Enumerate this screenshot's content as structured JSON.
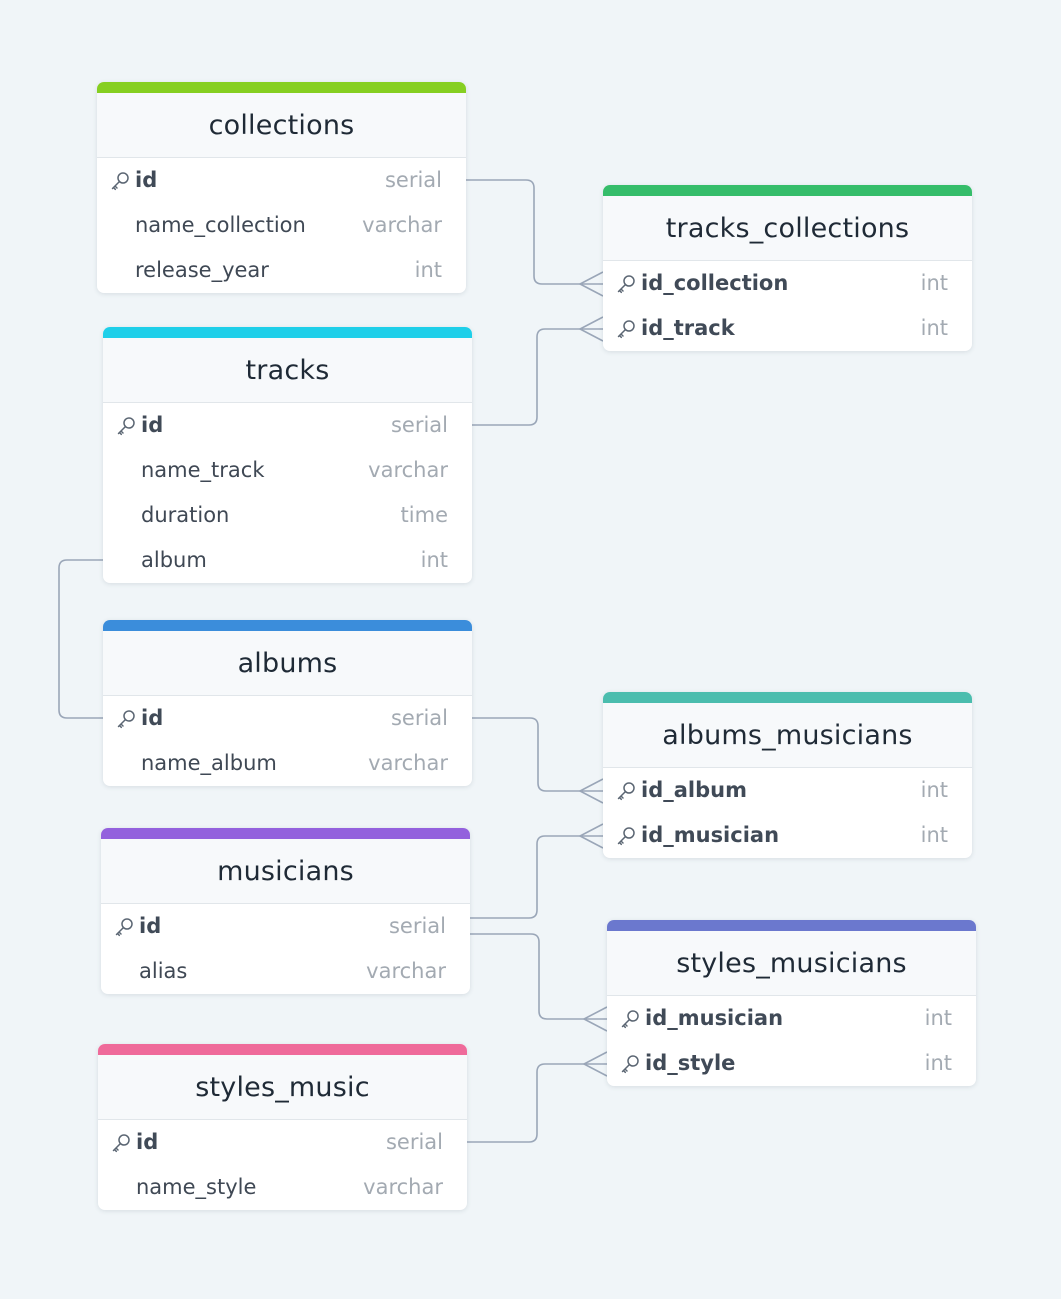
{
  "colors": {
    "background": "#f0f5f8",
    "line": "#9aa6b8",
    "collections": "#86cf21",
    "tracks": "#1ecfe9",
    "albums": "#3b8ddb",
    "musicians": "#9361dd",
    "styles_music": "#ef6a9a",
    "tracks_collections": "#35bd6a",
    "albums_musicians": "#4bbdae",
    "styles_musicians": "#6b78ce"
  },
  "tables": {
    "collections": {
      "name": "collections",
      "fields": [
        {
          "name": "id",
          "type": "serial",
          "pk": true
        },
        {
          "name": "name_collection",
          "type": "varchar",
          "pk": false
        },
        {
          "name": "release_year",
          "type": "int",
          "pk": false
        }
      ]
    },
    "tracks": {
      "name": "tracks",
      "fields": [
        {
          "name": "id",
          "type": "serial",
          "pk": true
        },
        {
          "name": "name_track",
          "type": "varchar",
          "pk": false
        },
        {
          "name": "duration",
          "type": "time",
          "pk": false
        },
        {
          "name": "album",
          "type": "int",
          "pk": false
        }
      ]
    },
    "albums": {
      "name": "albums",
      "fields": [
        {
          "name": "id",
          "type": "serial",
          "pk": true
        },
        {
          "name": "name_album",
          "type": "varchar",
          "pk": false
        }
      ]
    },
    "musicians": {
      "name": "musicians",
      "fields": [
        {
          "name": "id",
          "type": "serial",
          "pk": true
        },
        {
          "name": "alias",
          "type": "varchar",
          "pk": false
        }
      ]
    },
    "styles_music": {
      "name": "styles_music",
      "fields": [
        {
          "name": "id",
          "type": "serial",
          "pk": true
        },
        {
          "name": "name_style",
          "type": "varchar",
          "pk": false
        }
      ]
    },
    "tracks_collections": {
      "name": "tracks_collections",
      "fields": [
        {
          "name": "id_collection",
          "type": "int",
          "pk": true
        },
        {
          "name": "id_track",
          "type": "int",
          "pk": true
        }
      ]
    },
    "albums_musicians": {
      "name": "albums_musicians",
      "fields": [
        {
          "name": "id_album",
          "type": "int",
          "pk": true
        },
        {
          "name": "id_musician",
          "type": "int",
          "pk": true
        }
      ]
    },
    "styles_musicians": {
      "name": "styles_musicians",
      "fields": [
        {
          "name": "id_musician",
          "type": "int",
          "pk": true
        },
        {
          "name": "id_style",
          "type": "int",
          "pk": true
        }
      ]
    }
  },
  "relations": [
    {
      "from": "collections.id",
      "to": "tracks_collections.id_collection",
      "to_cardinality": "many"
    },
    {
      "from": "tracks.id",
      "to": "tracks_collections.id_track",
      "to_cardinality": "many"
    },
    {
      "from": "tracks.album",
      "to": "albums.id",
      "to_cardinality": "one"
    },
    {
      "from": "albums.id",
      "to": "albums_musicians.id_album",
      "to_cardinality": "many"
    },
    {
      "from": "musicians.id",
      "to": "albums_musicians.id_musician",
      "to_cardinality": "many"
    },
    {
      "from": "musicians.id",
      "to": "styles_musicians.id_musician",
      "to_cardinality": "many"
    },
    {
      "from": "styles_music.id",
      "to": "styles_musicians.id_style",
      "to_cardinality": "many"
    }
  ]
}
